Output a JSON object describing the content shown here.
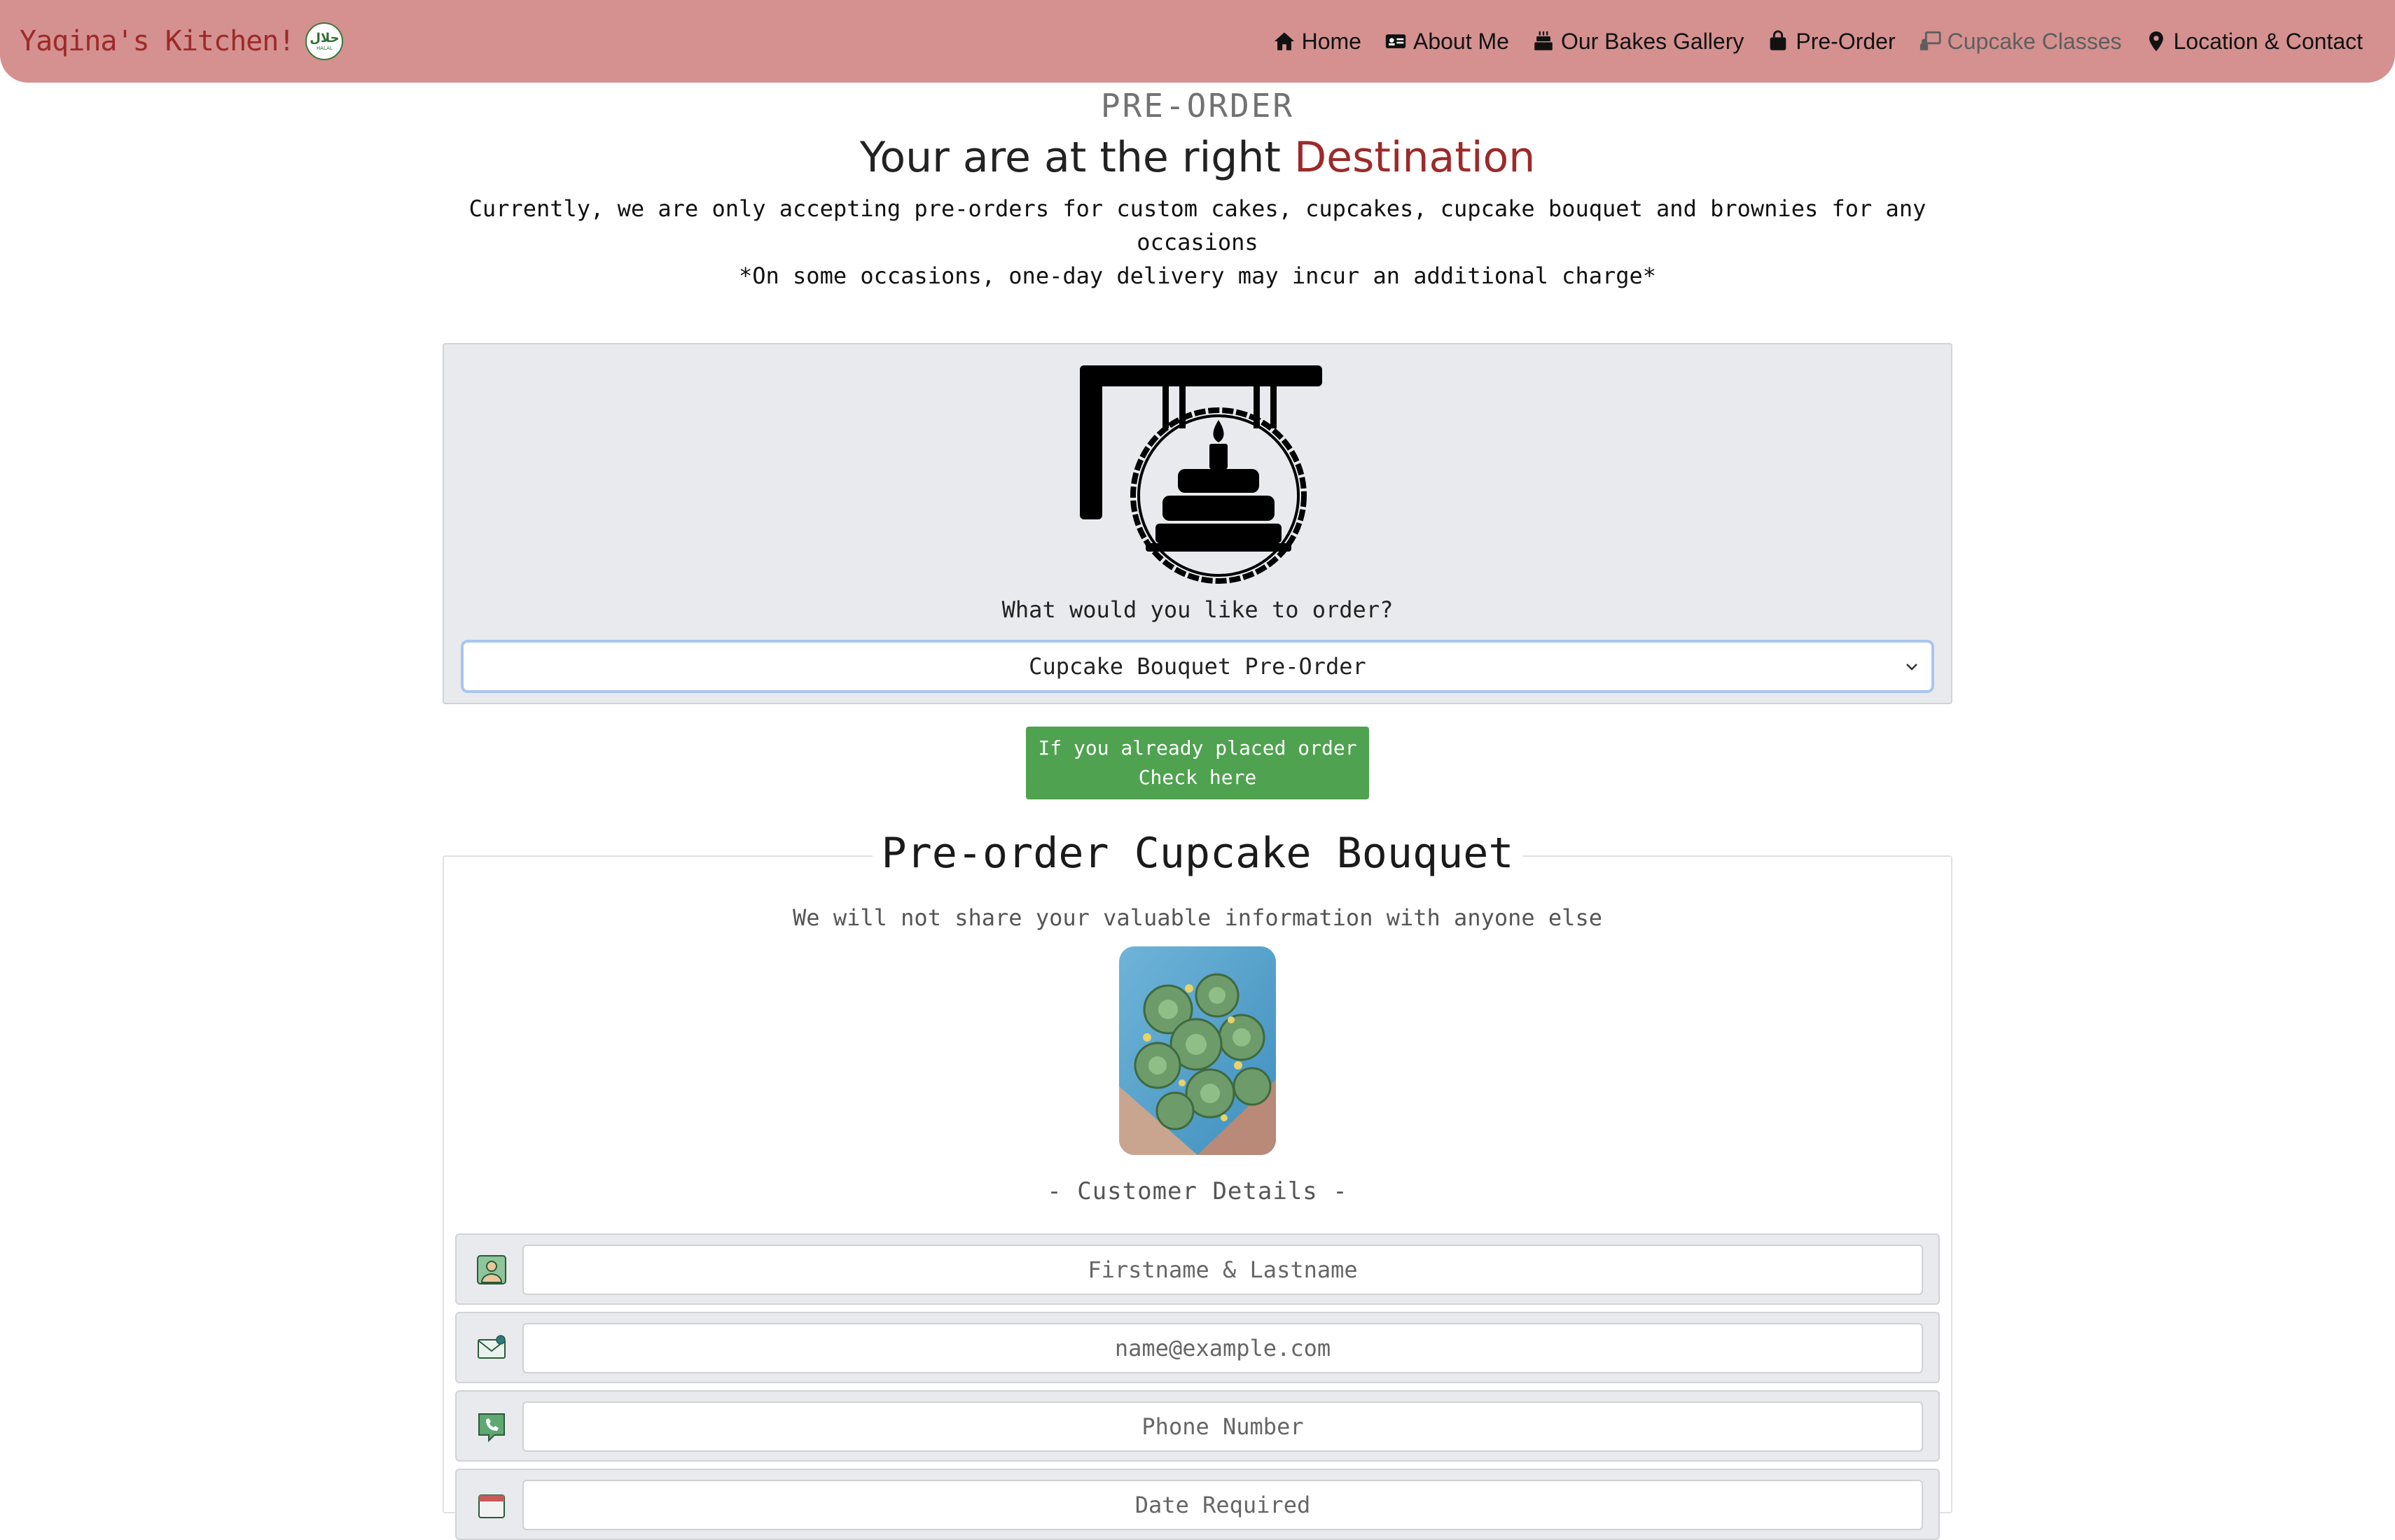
{
  "navbar": {
    "brand": "Yaqina's Kitchen!",
    "halal_badge_arabic": "حلال",
    "halal_badge_text": "HALAL",
    "links": [
      {
        "label": "Home",
        "icon": "home-icon"
      },
      {
        "label": "About Me",
        "icon": "id-card-icon"
      },
      {
        "label": "Our Bakes Gallery",
        "icon": "cake-icon"
      },
      {
        "label": "Pre-Order",
        "icon": "shopping-bag-icon"
      },
      {
        "label": "Cupcake Classes",
        "icon": "chalkboard-teacher-icon"
      },
      {
        "label": "Location & Contact",
        "icon": "map-pin-icon"
      }
    ],
    "active_link": "Cupcake Classes"
  },
  "hero": {
    "subtitle": "PRE-ORDER",
    "headline_prefix": "Your are at the right ",
    "headline_accent": "Destination",
    "intro_line1": "Currently, we are only accepting pre-orders for custom cakes, cupcakes, cupcake bouquet and brownies for any occasions",
    "intro_line2": "*On some occasions, one-day delivery may incur an additional charge*"
  },
  "order_select": {
    "icon": "cake-shop-sign-icon",
    "question": "What would you like to order?",
    "selected": "Cupcake Bouquet Pre-Order"
  },
  "check_order": {
    "line1": "If you already placed order",
    "line2": "Check here"
  },
  "form": {
    "title": "Pre-order Cupcake Bouquet",
    "privacy": "We will not share your valuable information with anyone else",
    "section_label": "- Customer Details -",
    "fields": [
      {
        "icon": "user-icon",
        "placeholder": "Firstname & Lastname"
      },
      {
        "icon": "mail-icon",
        "placeholder": "name@example.com"
      },
      {
        "icon": "phone-icon",
        "placeholder": "Phone Number"
      },
      {
        "icon": "calendar-icon",
        "placeholder": "Date Required"
      }
    ]
  },
  "colors": {
    "navbar_bg": "#d49190",
    "brand": "#9c2a2a",
    "accent": "#9c2a2a",
    "button_green": "#4fa24f",
    "card_bg": "#e9eaed"
  }
}
